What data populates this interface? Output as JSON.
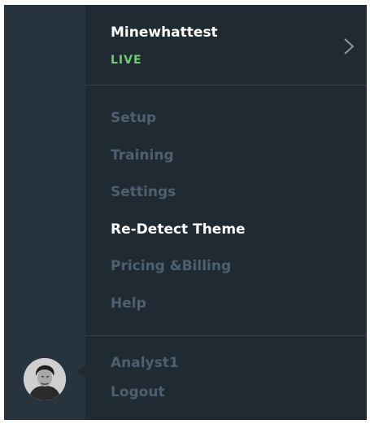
{
  "app": {
    "name": "Minewhattest",
    "status": "LIVE",
    "status_color": "#6ccf6c"
  },
  "menu": {
    "items": [
      {
        "label": "Setup",
        "active": false
      },
      {
        "label": "Training",
        "active": false
      },
      {
        "label": "Settings",
        "active": false
      },
      {
        "label": "Re-Detect Theme",
        "active": true
      },
      {
        "label": "Pricing &Billing",
        "active": false
      },
      {
        "label": "Help",
        "active": false
      }
    ]
  },
  "user": {
    "name": "Analyst1",
    "logout_label": "Logout",
    "avatar_icon": "user-avatar-portrait"
  },
  "icons": {
    "expand": "chevron-right-icon"
  },
  "colors": {
    "panel_bg": "#1f2a33",
    "rail_bg": "#27333d",
    "muted_text": "#4e6070",
    "active_text": "#ffffff"
  }
}
